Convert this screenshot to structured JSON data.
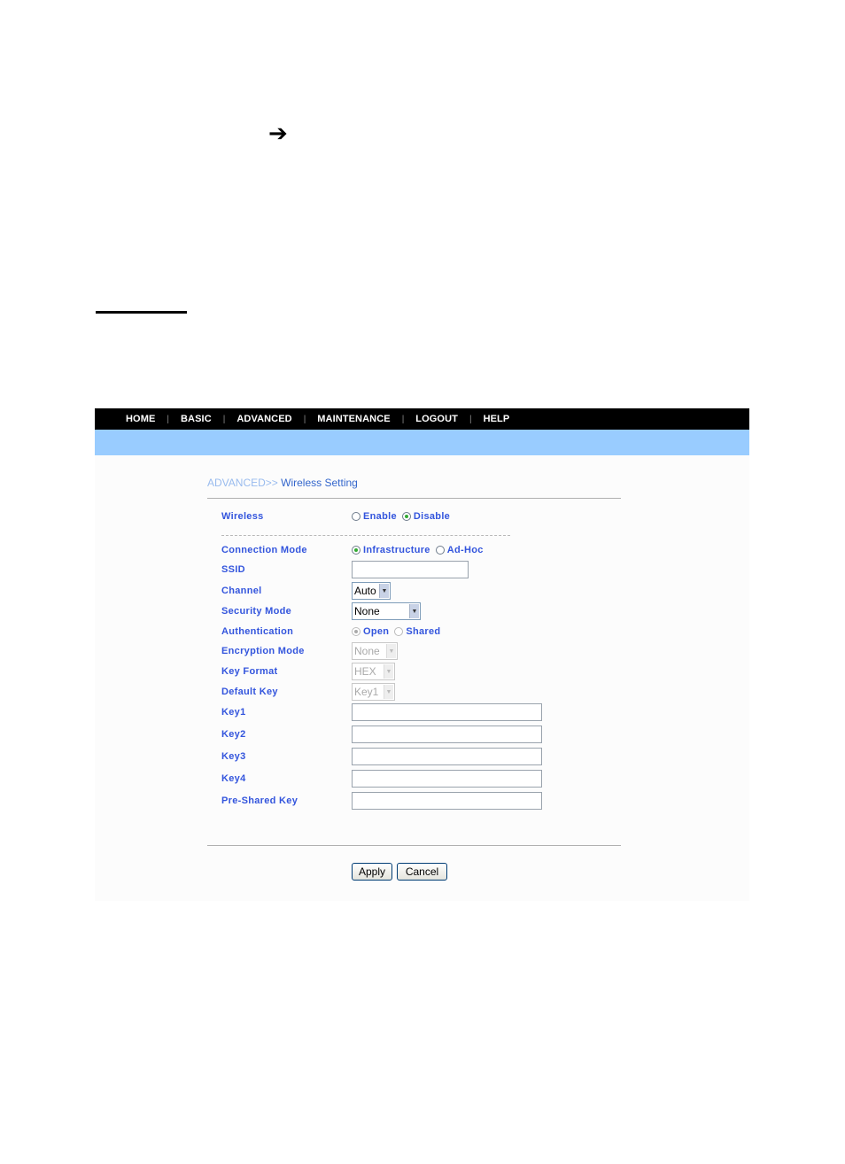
{
  "document": {
    "arrow_icon": "right-arrow"
  },
  "nav": {
    "items": [
      {
        "label": "HOME"
      },
      {
        "label": "BASIC"
      },
      {
        "label": "ADVANCED"
      },
      {
        "label": "MAINTENANCE"
      },
      {
        "label": "LOGOUT"
      },
      {
        "label": "HELP"
      }
    ],
    "separator": "|",
    "colors": {
      "bar": "#000000",
      "subbar": "#99ccff",
      "label": "#3355dd"
    }
  },
  "breadcrumb": {
    "root": "ADVANCED>>",
    "page": " Wireless Setting"
  },
  "form": {
    "wireless": {
      "label": "Wireless",
      "options": [
        {
          "label": "Enable",
          "checked": false
        },
        {
          "label": "Disable",
          "checked": true
        }
      ]
    },
    "connection_mode": {
      "label": "Connection Mode",
      "options": [
        {
          "label": "Infrastructure",
          "checked": true
        },
        {
          "label": "Ad-Hoc",
          "checked": false
        }
      ]
    },
    "ssid": {
      "label": "SSID",
      "value": ""
    },
    "channel": {
      "label": "Channel",
      "value": "Auto"
    },
    "security_mode": {
      "label": "Security Mode",
      "value": "None"
    },
    "authentication": {
      "label": "Authentication",
      "options": [
        {
          "label": "Open",
          "checked": true
        },
        {
          "label": "Shared",
          "checked": false
        }
      ],
      "disabled": true
    },
    "encryption_mode": {
      "label": "Encryption Mode",
      "value": "None",
      "disabled": true
    },
    "key_format": {
      "label": "Key Format",
      "value": "HEX",
      "disabled": true
    },
    "default_key": {
      "label": "Default Key",
      "value": "Key1",
      "disabled": true
    },
    "key1": {
      "label": "Key1",
      "value": ""
    },
    "key2": {
      "label": "Key2",
      "value": ""
    },
    "key3": {
      "label": "Key3",
      "value": ""
    },
    "key4": {
      "label": "Key4",
      "value": ""
    },
    "psk": {
      "label": "Pre-Shared Key",
      "value": ""
    }
  },
  "buttons": {
    "apply": "Apply",
    "cancel": "Cancel"
  }
}
